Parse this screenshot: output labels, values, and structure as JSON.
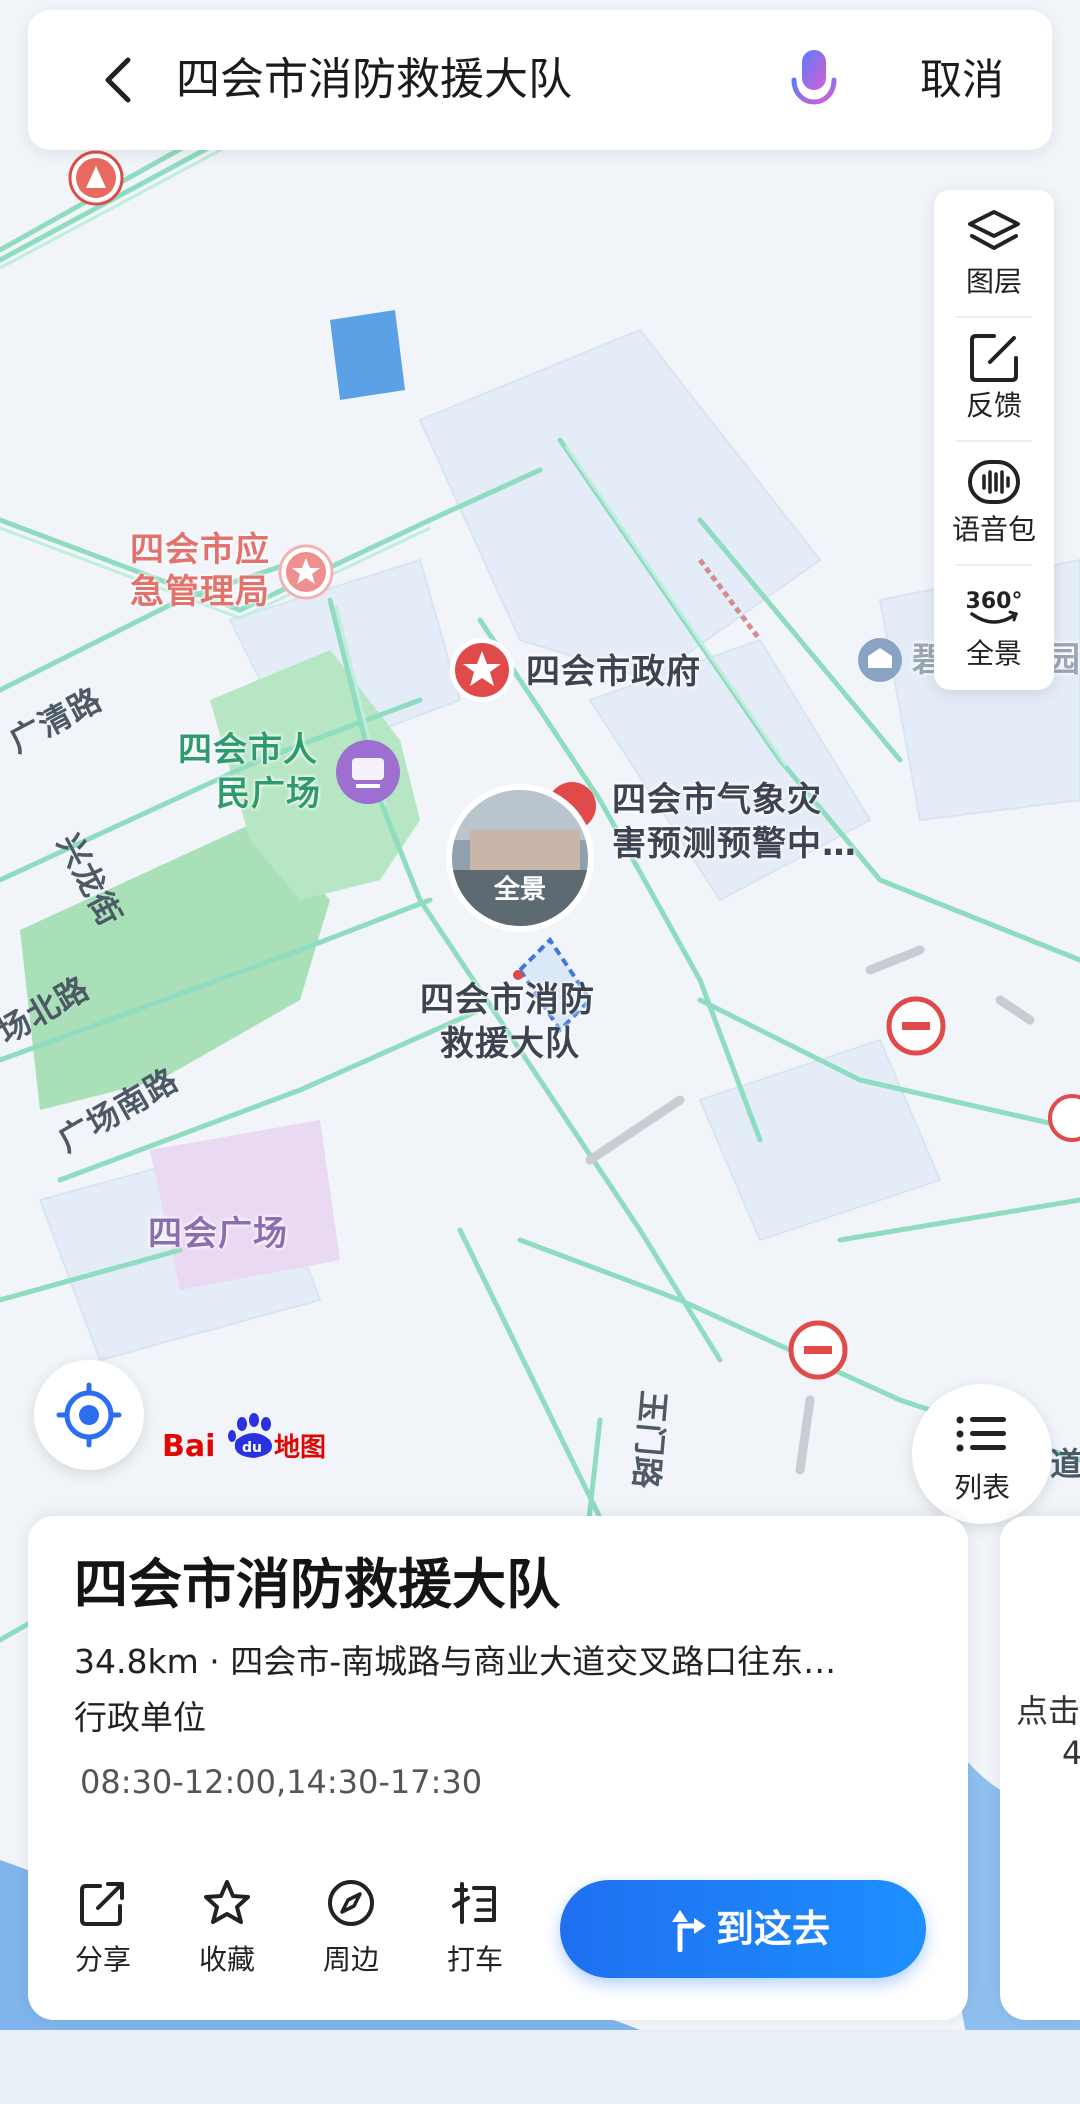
{
  "search": {
    "query": "四会市消防救援大队",
    "cancel_label": "取消"
  },
  "tools": [
    {
      "label": "图层",
      "icon": "layers-icon"
    },
    {
      "label": "反馈",
      "icon": "feedback-icon"
    },
    {
      "label": "语音包",
      "icon": "voice-pack-icon"
    },
    {
      "label": "全景",
      "icon": "panorama-360-icon",
      "badge": "360°"
    }
  ],
  "map": {
    "poi": {
      "emergency_bureau": "四会市应急管理局",
      "emergency_bureau_l1": "四会市应",
      "emergency_bureau_l2": "急管理局",
      "government": "四会市政府",
      "plaza_l1": "四会市人",
      "plaza_l2": "民广场",
      "weather_l1": "四会市气象灾",
      "weather_l2": "害预测预警中…",
      "fire_l1": "四会市消防",
      "fire_l2": "救援大队",
      "square": "四会广场",
      "east_partial": "碧",
      "east_partial2": "园"
    },
    "roads": {
      "guangqing": "广清路",
      "xinglong": "兴龙街",
      "north": "场北路",
      "south": "广场南路",
      "road_east": "道",
      "road_bottom": "玉门路"
    },
    "panorama_label": "全景",
    "logo_text_bai": "Bai",
    "logo_text_du": "du",
    "logo_text_map": "地图"
  },
  "list_button_label": "列表",
  "place": {
    "name": "四会市消防救援大队",
    "distance_address": "34.8km · 四会市-南城路与商业大道交叉路口往东…",
    "category": "行政单位",
    "hours": "08:30-12:00,14:30-17:30"
  },
  "actions": [
    {
      "label": "分享",
      "icon": "share-icon"
    },
    {
      "label": "收藏",
      "icon": "star-icon"
    },
    {
      "label": "周边",
      "icon": "compass-icon"
    },
    {
      "label": "打车",
      "icon": "taxi-icon"
    }
  ],
  "goto_label": "到这去",
  "next_card": {
    "line1": "点击",
    "line2": "4"
  },
  "colors": {
    "accent": "#1e7ff5",
    "road": "#86d9bd",
    "poi_red": "#e04a4a",
    "park": "#9fdcb1"
  }
}
